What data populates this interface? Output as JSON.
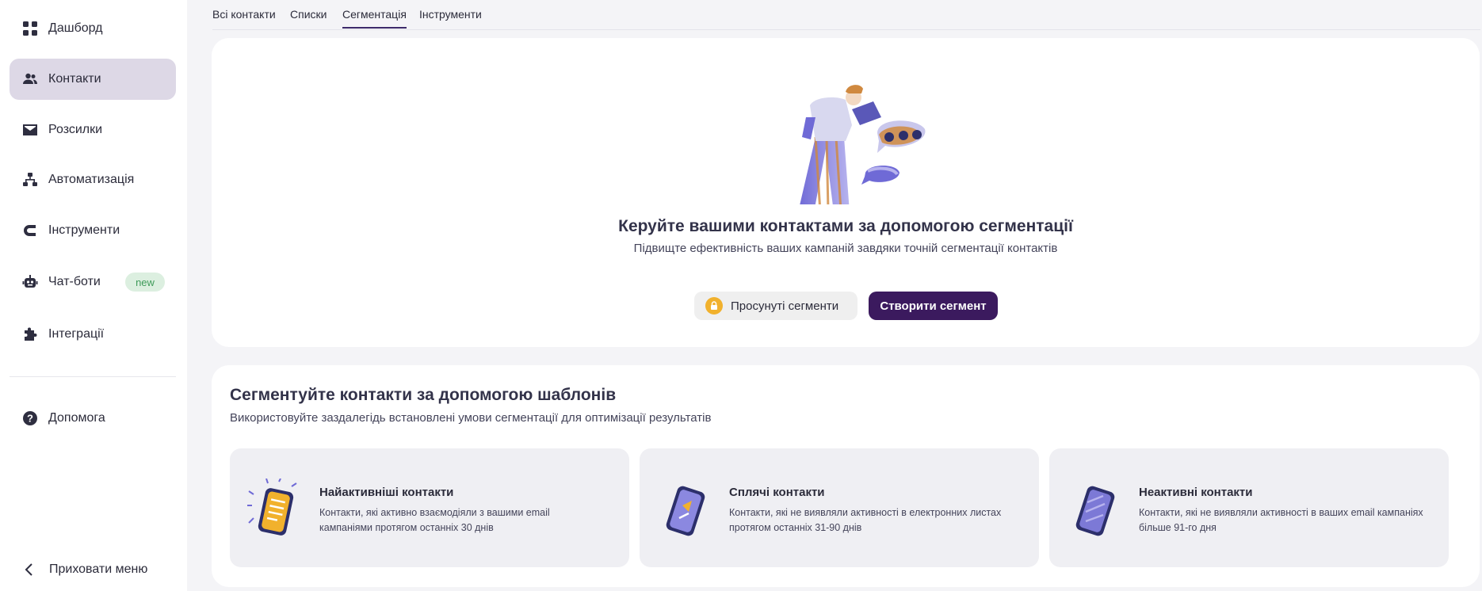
{
  "sidebar": {
    "items": [
      {
        "label": "Дашборд",
        "icon": "grid-icon"
      },
      {
        "label": "Контакти",
        "icon": "people-icon",
        "active": true
      },
      {
        "label": "Розсилки",
        "icon": "envelope-icon"
      },
      {
        "label": "Автоматизація",
        "icon": "hierarchy-icon"
      },
      {
        "label": "Інструменти",
        "icon": "magnet-icon"
      },
      {
        "label": "Чат-боти",
        "icon": "robot-icon",
        "badge": "new"
      },
      {
        "label": "Інтеграції",
        "icon": "puzzle-icon"
      }
    ],
    "help": "Допомога",
    "collapse": "Приховати меню"
  },
  "tabs": [
    "Всі контакти",
    "Списки",
    "Сегментація",
    "Інструменти"
  ],
  "active_tab": "Сегментація",
  "hero": {
    "title": "Керуйте вашими контактами за допомогою сегментації",
    "subtitle": "Підвищте ефективність ваших кампаній завдяки точній сегментації контактів",
    "advanced_button": "Просунуті сегменти",
    "create_button": "Створити сегмент"
  },
  "templates": {
    "title": "Сегментуйте контакти за допомогою шаблонів",
    "subtitle": "Використовуйте заздалегідь встановлені умови сегментації для оптимізації результатів",
    "cards": [
      {
        "name": "Найактивніші контакти",
        "description": "Контакти, які активно взаємодіяли з вашими email кампаніями протягом останніх 30 днів"
      },
      {
        "name": "Сплячі контакти",
        "description": "Контакти, які не виявляли активності в електронних листах протягом останніх 31-90 днів"
      },
      {
        "name": "Неактивні контакти",
        "description": "Контакти, які не виявляли активності в ваших email кампаніях більше 91-го дня"
      }
    ]
  },
  "colors": {
    "primary": "#3b1a5e",
    "active_nav": "#ddd8e6",
    "badge_bg": "#dcefe0",
    "badge_text": "#3f9b5a",
    "lock": "#f1b12d"
  }
}
